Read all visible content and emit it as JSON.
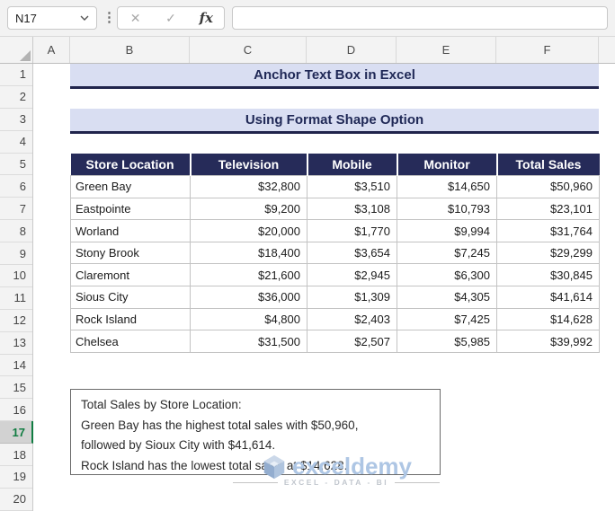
{
  "topbar": {
    "name_box": "N17",
    "formula": "",
    "cancel_icon": "✕",
    "confirm_icon": "✓",
    "fx_icon": "fx",
    "more_icon": "⋮"
  },
  "grid": {
    "columns": [
      "A",
      "B",
      "C",
      "D",
      "E",
      "F"
    ],
    "row_numbers": [
      "1",
      "2",
      "3",
      "4",
      "5",
      "6",
      "7",
      "8",
      "9",
      "10",
      "11",
      "12",
      "13",
      "14",
      "15",
      "16",
      "17",
      "18",
      "19",
      "20"
    ],
    "active_row": "17"
  },
  "banners": {
    "title": "Anchor Text Box in Excel",
    "section": "Using Format Shape Option"
  },
  "table": {
    "headers": [
      "Store Location",
      "Television",
      "Mobile",
      "Monitor",
      "Total Sales"
    ],
    "rows": [
      [
        "Green Bay",
        "$32,800",
        "$3,510",
        "$14,650",
        "$50,960"
      ],
      [
        "Eastpointe",
        "$9,200",
        "$3,108",
        "$10,793",
        "$23,101"
      ],
      [
        "Worland",
        "$20,000",
        "$1,770",
        "$9,994",
        "$31,764"
      ],
      [
        "Stony Brook",
        "$18,400",
        "$3,654",
        "$7,245",
        "$29,299"
      ],
      [
        "Claremont",
        "$21,600",
        "$2,945",
        "$6,300",
        "$30,845"
      ],
      [
        "Sious City",
        "$36,000",
        "$1,309",
        "$4,305",
        "$41,614"
      ],
      [
        "Rock Island",
        "$4,800",
        "$2,403",
        "$7,425",
        "$14,628"
      ],
      [
        "Chelsea",
        "$31,500",
        "$2,507",
        "$5,985",
        "$39,992"
      ]
    ]
  },
  "textbox": {
    "lines": [
      "Total Sales by Store Location:",
      "Green Bay has the highest total sales with $50,960,",
      "followed by Sioux City with $41,614.",
      "Rock Island has the lowest total sales at $14,628."
    ]
  },
  "watermark": {
    "brand": "exceldemy",
    "tagline": "EXCEL - DATA - BI"
  },
  "colors": {
    "banner_bg": "#D9DEF2",
    "banner_text": "#1F2856",
    "banner_underline": "#20244C",
    "table_header_bg": "#262B59",
    "active_row_green": "#107C41",
    "watermark_blue": "#AEC6E4"
  }
}
